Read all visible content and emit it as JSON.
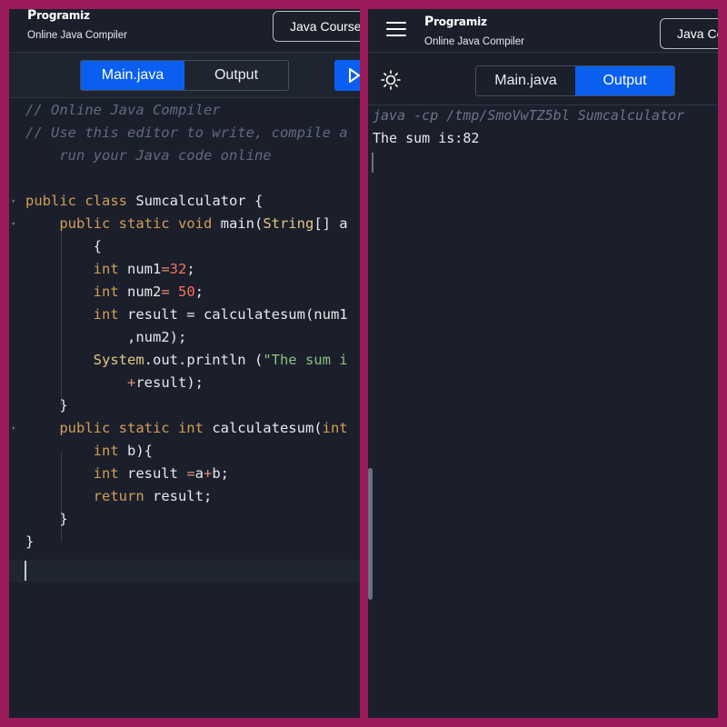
{
  "header": {
    "logo_text": "rogramiz",
    "logo_mark": "P",
    "subtitle": "Online Java Compiler",
    "course_button": "Java Course",
    "course_button_right": "Java Co"
  },
  "tabs": {
    "main": "Main.java",
    "output": "Output"
  },
  "left_active_tab": "Main.java",
  "right_active_tab": "Output",
  "code": {
    "c1": "// Online Java Compiler",
    "c2": "// Use this editor to write, compile a",
    "c3": "    run your Java code online",
    "l5": {
      "a": "public class ",
      "b": "Sumcalculator",
      "c": " {"
    },
    "l6": {
      "a": "    public static void ",
      "b": "main(",
      "c": "String",
      "d": "[] a"
    },
    "l7": "        {",
    "l8": {
      "a": "        int ",
      "b": "num1",
      "c": "=",
      "d": "32",
      "e": ";"
    },
    "l9": {
      "a": "        int ",
      "b": "num2",
      "c": "= ",
      "d": "50",
      "e": ";"
    },
    "l10": {
      "a": "        int ",
      "b": "result = calculatesum(num1"
    },
    "l11": "            ,num2);",
    "l12": {
      "a": "        System",
      "b": ".out.println (",
      "c": "\"The sum i"
    },
    "l13": {
      "a": "            ",
      "b": "+",
      "c": "result);"
    },
    "l14": "    }",
    "l15": {
      "a": "    public static int ",
      "b": "calculatesum(",
      "c": "int"
    },
    "l16": {
      "a": "        int ",
      "b": "b){"
    },
    "l17": {
      "a": "        int ",
      "b": "result ",
      "c": "=",
      "d": "a",
      "e": "+",
      "f": "b;"
    },
    "l18": {
      "a": "        return ",
      "b": "result;"
    },
    "l19": "    }",
    "l20": "}"
  },
  "output": {
    "command": "java -cp /tmp/SmoVwTZ5bl Sumcalculator",
    "result": "The sum is:82"
  },
  "colors": {
    "accent": "#0a5ff0",
    "frame": "#9b1b5a",
    "background": "#1a1f2b"
  },
  "icons": [
    "hamburger-icon",
    "sun-icon",
    "run-icon",
    "fold-arrow-icon"
  ]
}
